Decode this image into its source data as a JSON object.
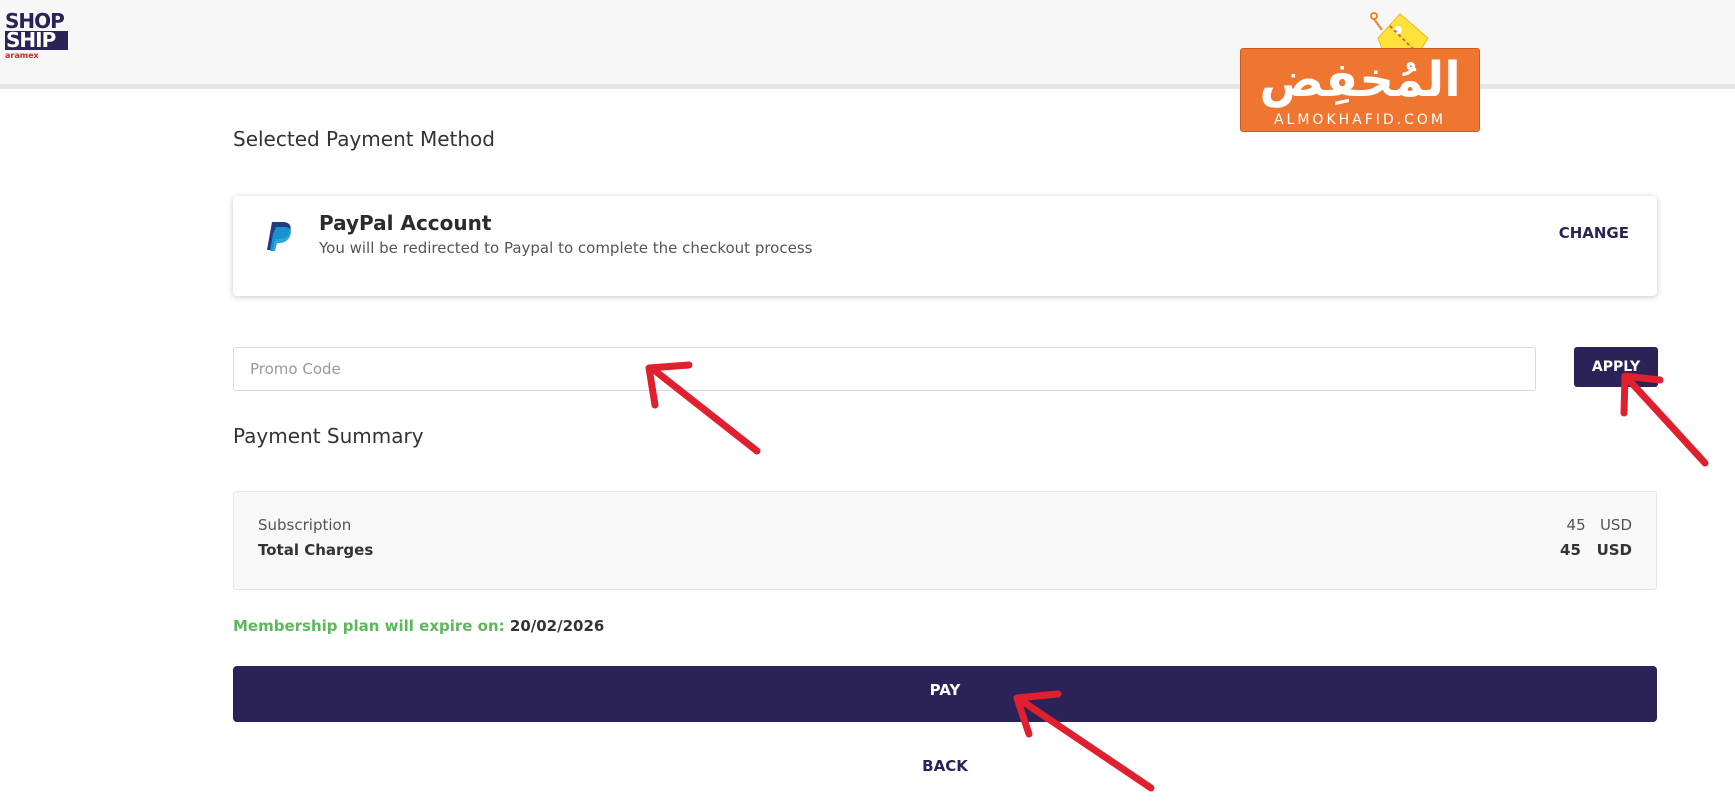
{
  "header": {
    "logo_line1": "SHOP",
    "logo_line2": "SHIP",
    "logo_brand": "aramex"
  },
  "watermark": {
    "arabic": "المُخفِض",
    "latin": "ALMOKHAFID.COM"
  },
  "payment_method": {
    "heading": "Selected Payment Method",
    "title": "PayPal Account",
    "description": "You will be redirected to Paypal to complete the checkout process",
    "change_label": "CHANGE"
  },
  "promo": {
    "placeholder": "Promo Code",
    "value": "",
    "apply_label": "APPLY"
  },
  "summary": {
    "heading": "Payment Summary",
    "rows": [
      {
        "label": "Subscription",
        "amount": "45",
        "currency": "USD"
      },
      {
        "label": "Total Charges",
        "amount": "45",
        "currency": "USD"
      }
    ]
  },
  "membership": {
    "label": "Membership plan will expire on:",
    "date": "20/02/2026"
  },
  "actions": {
    "pay_label": "PAY",
    "back_label": "BACK"
  },
  "colors": {
    "brand": "#2b2358",
    "accent_green": "#5cb85c",
    "arrow_red": "#e0202e",
    "watermark_orange": "#ee7630"
  }
}
